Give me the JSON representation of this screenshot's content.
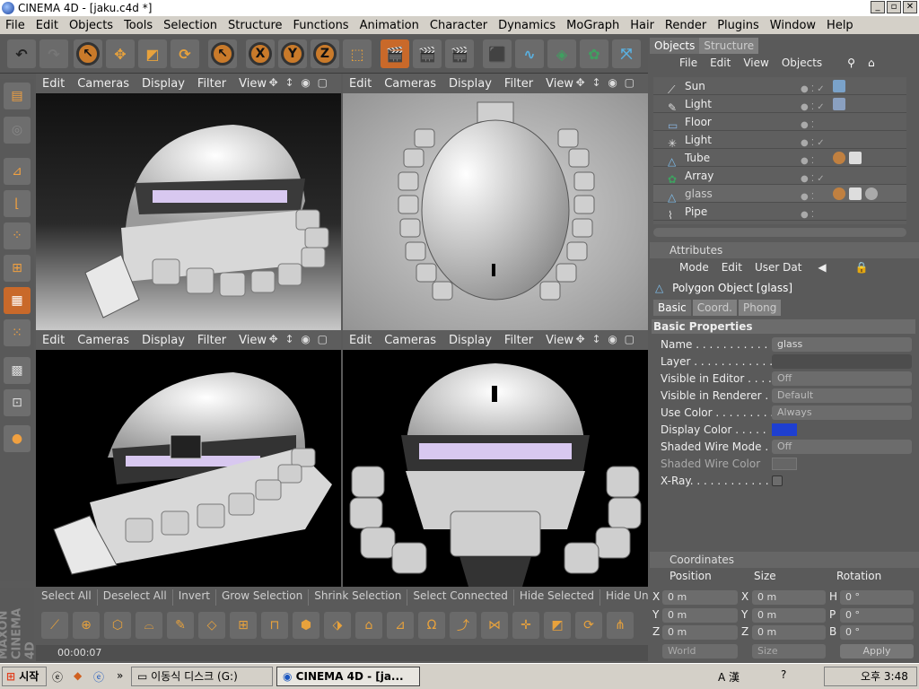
{
  "window": {
    "title": "CINEMA 4D - [jaku.c4d *]",
    "minimize": "_",
    "maximize": "▫",
    "close": "✕"
  },
  "menu": [
    "File",
    "Edit",
    "Objects",
    "Tools",
    "Selection",
    "Structure",
    "Functions",
    "Animation",
    "Character",
    "Dynamics",
    "MoGraph",
    "Hair",
    "Render",
    "Plugins",
    "Window",
    "Help"
  ],
  "toolbar": {
    "x": "X",
    "y": "Y",
    "z": "Z"
  },
  "viewport_menu": [
    "Edit",
    "Cameras",
    "Display",
    "Filter",
    "View"
  ],
  "viewport_nav": "✥ ↕ ◉ ▢",
  "object_panel": {
    "tabs": [
      "Objects",
      "Structure"
    ],
    "menu": [
      "File",
      "Edit",
      "View",
      "Objects"
    ],
    "objects": [
      {
        "name": "Sun",
        "icon": "light-icon"
      },
      {
        "name": "Light",
        "icon": "light-icon"
      },
      {
        "name": "Floor",
        "icon": "floor-icon"
      },
      {
        "name": "Light",
        "icon": "light-icon"
      },
      {
        "name": "Tube",
        "icon": "tube-icon"
      },
      {
        "name": "Array",
        "icon": "array-icon"
      },
      {
        "name": "glass",
        "icon": "polygon-icon"
      },
      {
        "name": "Pipe",
        "icon": "pipe-icon"
      }
    ]
  },
  "attributes": {
    "title": "Attributes",
    "menu": [
      "Mode",
      "Edit",
      "User Dat"
    ],
    "object_name": "Polygon Object [glass]",
    "tabs": [
      "Basic",
      "Coord.",
      "Phong"
    ],
    "section": "Basic Properties",
    "rows": [
      {
        "label": "Name . . . . . . . . . . . . .",
        "value": "glass"
      },
      {
        "label": "Layer . . . . . . . . . . . . .",
        "value": ""
      },
      {
        "label": "Visible in Editor . . . . .",
        "value": "Off"
      },
      {
        "label": "Visible in Renderer . .",
        "value": "Default"
      },
      {
        "label": "Use Color . . . . . . . . . .",
        "value": "Always"
      },
      {
        "label": "Display Color . . . . .",
        "value": ""
      },
      {
        "label": "Shaded Wire Mode . .",
        "value": "Off"
      },
      {
        "label": "Shaded Wire Color",
        "value": ""
      },
      {
        "label": "X-Ray. . . . . . . . . . . . .",
        "value": ""
      }
    ],
    "display_color": "#1e3fd0"
  },
  "coordinates": {
    "title": "Coordinates",
    "headers": [
      "Position",
      "Size",
      "Rotation"
    ],
    "rows": [
      {
        "a": "X",
        "av": "0 m",
        "b": "X",
        "bv": "0 m",
        "c": "H",
        "cv": "0 °"
      },
      {
        "a": "Y",
        "av": "0 m",
        "b": "Y",
        "bv": "0 m",
        "c": "P",
        "cv": "0 °"
      },
      {
        "a": "Z",
        "av": "0 m",
        "b": "Z",
        "bv": "0 m",
        "c": "B",
        "cv": "0 °"
      }
    ],
    "world": "World",
    "size": "Size",
    "apply": "Apply"
  },
  "selection_bar": [
    "Select All",
    "Deselect All",
    "Invert",
    "Grow Selection",
    "Shrink Selection",
    "Select Connected",
    "Hide Selected",
    "Hide Unse"
  ],
  "status": {
    "time": "00:00:07"
  },
  "maxon": "MAXON CINEMA 4D",
  "taskbar": {
    "start": "시작",
    "disk": "이동식 디스크 (G:)",
    "app": "CINEMA 4D - [ja...",
    "time": "오후 3:48",
    "quick": "»",
    "ime": "A 漢"
  }
}
